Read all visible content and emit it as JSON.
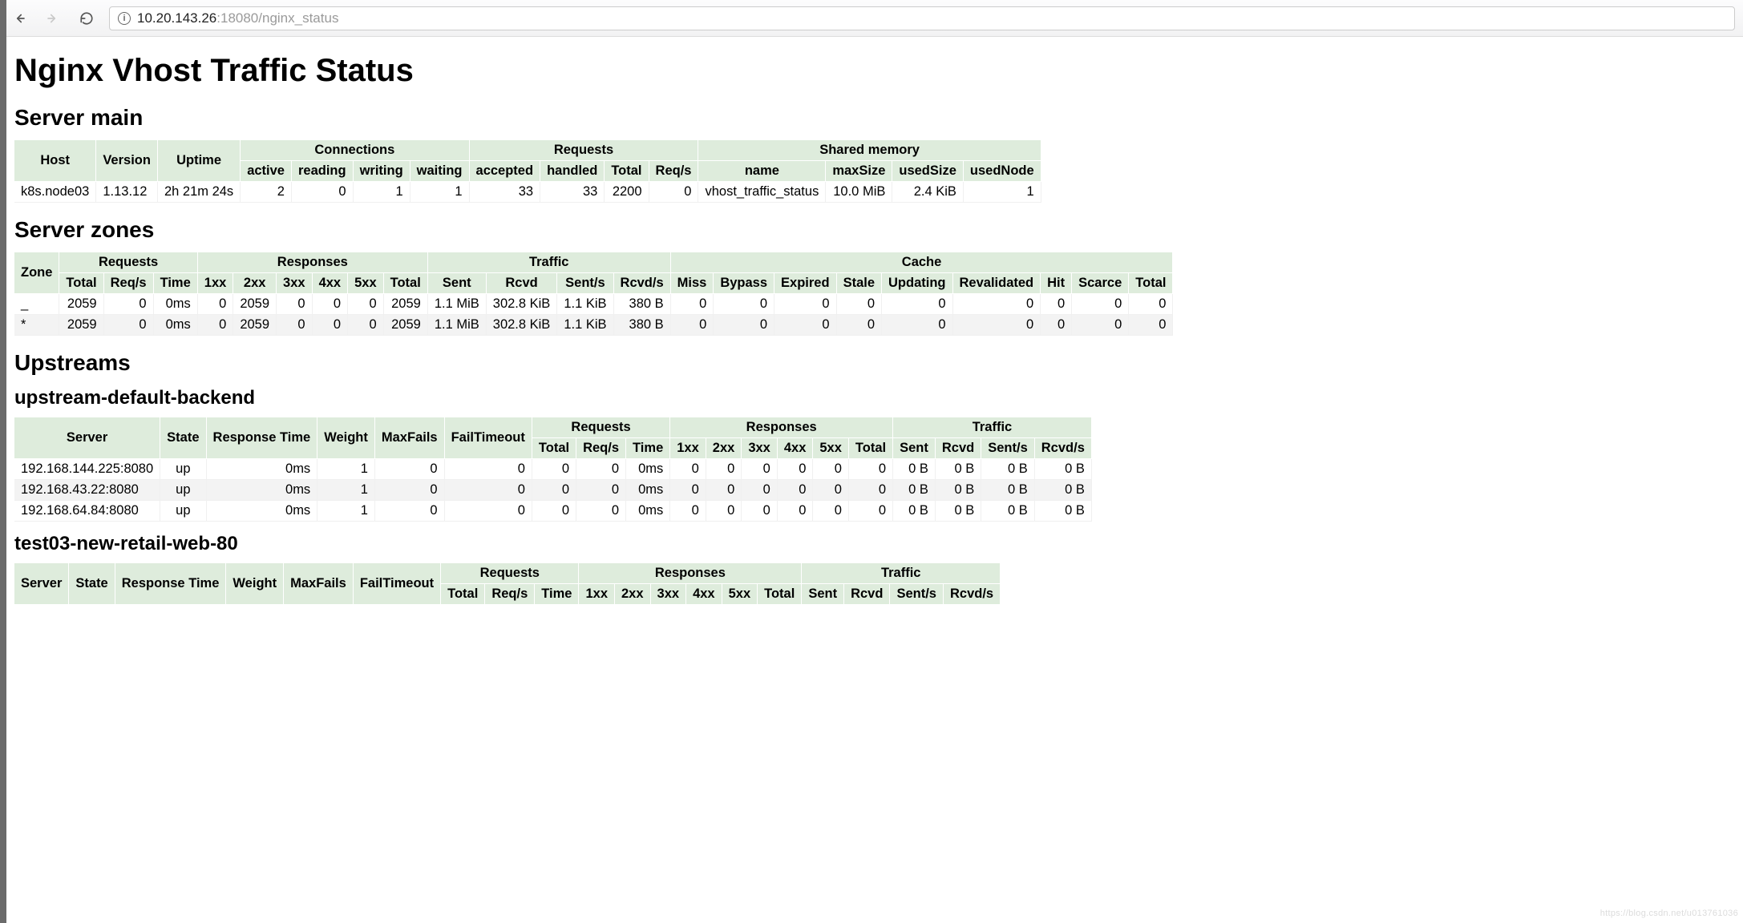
{
  "browser": {
    "url_host_path": "10.20.143.26",
    "url_port": ":18080",
    "url_rest": "/nginx_status"
  },
  "page_title": "Nginx Vhost Traffic Status",
  "server_main": {
    "heading": "Server main",
    "headers": {
      "host": "Host",
      "version": "Version",
      "uptime": "Uptime",
      "connections": "Connections",
      "active": "active",
      "reading": "reading",
      "writing": "writing",
      "waiting": "waiting",
      "requests": "Requests",
      "accepted": "accepted",
      "handled": "handled",
      "total": "Total",
      "reqs": "Req/s",
      "shared_memory": "Shared memory",
      "name": "name",
      "maxSize": "maxSize",
      "usedSize": "usedSize",
      "usedNode": "usedNode"
    },
    "row": {
      "host": "k8s.node03",
      "version": "1.13.12",
      "uptime": "2h 21m 24s",
      "active": "2",
      "reading": "0",
      "writing": "1",
      "waiting": "1",
      "accepted": "33",
      "handled": "33",
      "total": "2200",
      "reqs": "0",
      "name": "vhost_traffic_status",
      "maxSize": "10.0 MiB",
      "usedSize": "2.4 KiB",
      "usedNode": "1"
    }
  },
  "server_zones": {
    "heading": "Server zones",
    "headers": {
      "zone": "Zone",
      "requests": "Requests",
      "responses": "Responses",
      "traffic": "Traffic",
      "cache": "Cache",
      "total": "Total",
      "reqs": "Req/s",
      "time": "Time",
      "1xx": "1xx",
      "2xx": "2xx",
      "3xx": "3xx",
      "4xx": "4xx",
      "5xx": "5xx",
      "rtotal": "Total",
      "sent": "Sent",
      "rcvd": "Rcvd",
      "sents": "Sent/s",
      "rcvds": "Rcvd/s",
      "miss": "Miss",
      "bypass": "Bypass",
      "expired": "Expired",
      "stale": "Stale",
      "updating": "Updating",
      "revalidated": "Revalidated",
      "hit": "Hit",
      "scarce": "Scarce",
      "ctotal": "Total"
    },
    "rows": [
      {
        "zone": "_",
        "total": "2059",
        "reqs": "0",
        "time": "0ms",
        "1xx": "0",
        "2xx": "2059",
        "3xx": "0",
        "4xx": "0",
        "5xx": "0",
        "rtotal": "2059",
        "sent": "1.1 MiB",
        "rcvd": "302.8 KiB",
        "sents": "1.1 KiB",
        "rcvds": "380 B",
        "miss": "0",
        "bypass": "0",
        "expired": "0",
        "stale": "0",
        "updating": "0",
        "revalidated": "0",
        "hit": "0",
        "scarce": "0",
        "ctotal": "0"
      },
      {
        "zone": "*",
        "total": "2059",
        "reqs": "0",
        "time": "0ms",
        "1xx": "0",
        "2xx": "2059",
        "3xx": "0",
        "4xx": "0",
        "5xx": "0",
        "rtotal": "2059",
        "sent": "1.1 MiB",
        "rcvd": "302.8 KiB",
        "sents": "1.1 KiB",
        "rcvds": "380 B",
        "miss": "0",
        "bypass": "0",
        "expired": "0",
        "stale": "0",
        "updating": "0",
        "revalidated": "0",
        "hit": "0",
        "scarce": "0",
        "ctotal": "0"
      }
    ]
  },
  "upstreams": {
    "heading": "Upstreams",
    "headers": {
      "server": "Server",
      "state": "State",
      "resp_time": "Response Time",
      "weight": "Weight",
      "maxfails": "MaxFails",
      "failtimeout": "FailTimeout",
      "requests": "Requests",
      "total": "Total",
      "reqs": "Req/s",
      "time": "Time",
      "responses": "Responses",
      "1xx": "1xx",
      "2xx": "2xx",
      "3xx": "3xx",
      "4xx": "4xx",
      "5xx": "5xx",
      "rtotal": "Total",
      "traffic": "Traffic",
      "sent": "Sent",
      "rcvd": "Rcvd",
      "sents": "Sent/s",
      "rcvds": "Rcvd/s"
    },
    "groups": [
      {
        "name": "upstream-default-backend",
        "rows": [
          {
            "server": "192.168.144.225:8080",
            "state": "up",
            "resp_time": "0ms",
            "weight": "1",
            "maxfails": "0",
            "failtimeout": "0",
            "total": "0",
            "reqs": "0",
            "time": "0ms",
            "1xx": "0",
            "2xx": "0",
            "3xx": "0",
            "4xx": "0",
            "5xx": "0",
            "rtotal": "0",
            "sent": "0 B",
            "rcvd": "0 B",
            "sents": "0 B",
            "rcvds": "0 B"
          },
          {
            "server": "192.168.43.22:8080",
            "state": "up",
            "resp_time": "0ms",
            "weight": "1",
            "maxfails": "0",
            "failtimeout": "0",
            "total": "0",
            "reqs": "0",
            "time": "0ms",
            "1xx": "0",
            "2xx": "0",
            "3xx": "0",
            "4xx": "0",
            "5xx": "0",
            "rtotal": "0",
            "sent": "0 B",
            "rcvd": "0 B",
            "sents": "0 B",
            "rcvds": "0 B"
          },
          {
            "server": "192.168.64.84:8080",
            "state": "up",
            "resp_time": "0ms",
            "weight": "1",
            "maxfails": "0",
            "failtimeout": "0",
            "total": "0",
            "reqs": "0",
            "time": "0ms",
            "1xx": "0",
            "2xx": "0",
            "3xx": "0",
            "4xx": "0",
            "5xx": "0",
            "rtotal": "0",
            "sent": "0 B",
            "rcvd": "0 B",
            "sents": "0 B",
            "rcvds": "0 B"
          }
        ]
      },
      {
        "name": "test03-new-retail-web-80",
        "rows": []
      }
    ]
  },
  "watermark": "https://blog.csdn.net/u013761036"
}
